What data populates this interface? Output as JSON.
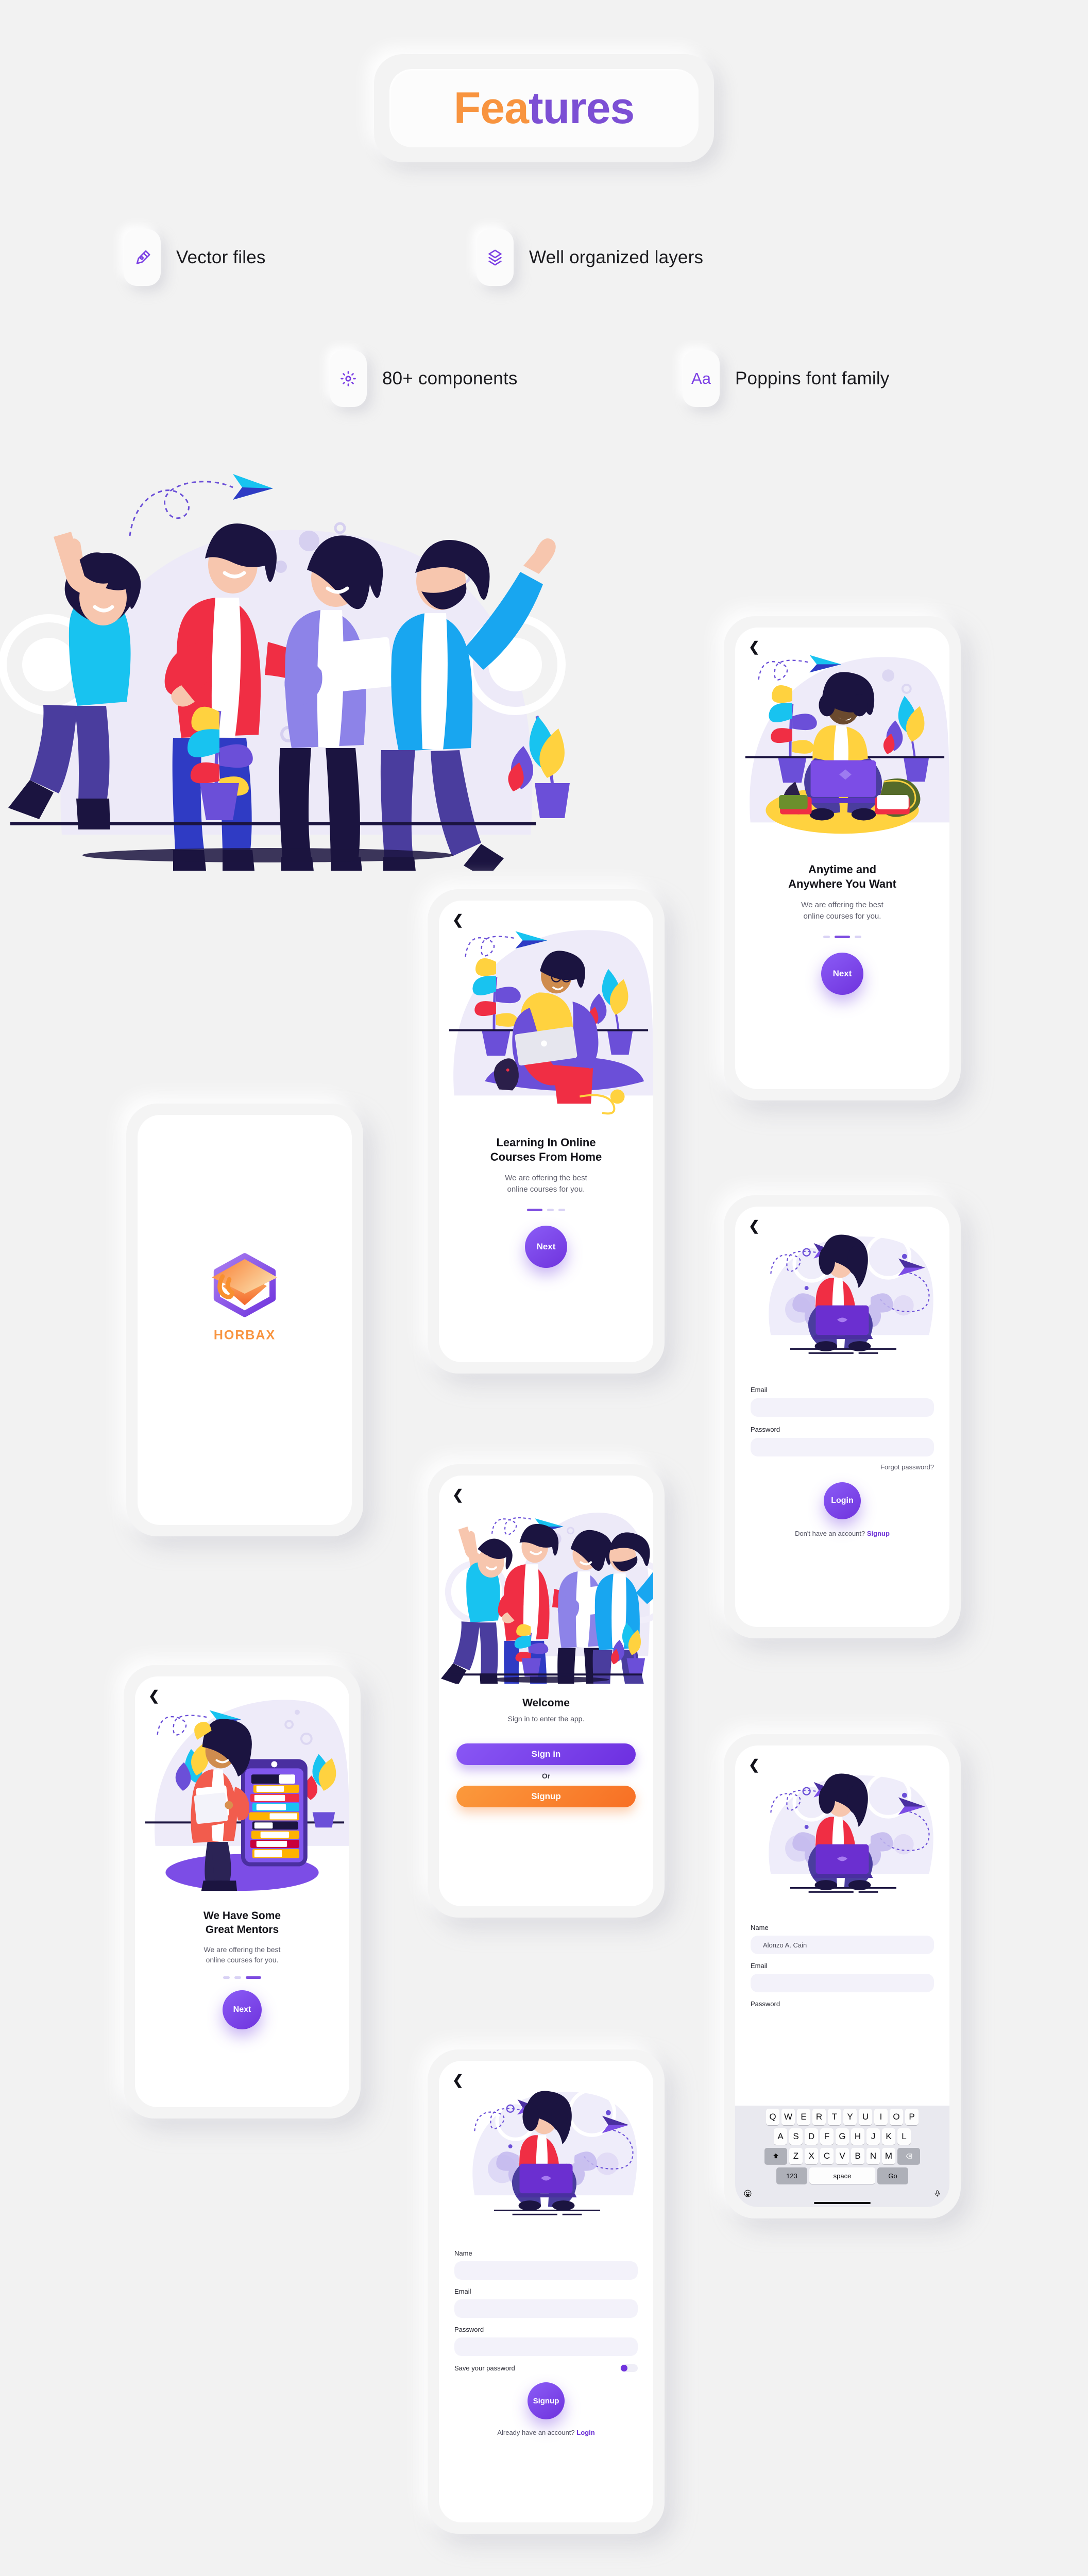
{
  "header": {
    "title_orange": "Fea",
    "title_purple": "tures"
  },
  "features": [
    {
      "icon": "pen-tool-icon",
      "label": "Vector files"
    },
    {
      "icon": "layers-icon",
      "label": "Well organized layers"
    },
    {
      "icon": "gear-icon",
      "label": "80+ components"
    },
    {
      "icon": "typography-icon",
      "label": "Poppins font family",
      "glyph": "Aa"
    }
  ],
  "splash": {
    "brand": "HORBAX"
  },
  "onboarding_1": {
    "title_line1": "Learning In Online",
    "title_line2": "Courses From Home",
    "sub_line1": "We are offering the best",
    "sub_line2": "online courses for you.",
    "button": "Next",
    "active_dot": 0,
    "dot_count": 3
  },
  "onboarding_2": {
    "title_line1": "Anytime and",
    "title_line2": "Anywhere You Want",
    "sub_line1": "We are offering the best",
    "sub_line2": "online courses for you.",
    "button": "Next",
    "active_dot": 1,
    "dot_count": 3
  },
  "onboarding_3": {
    "title_line1": "We Have Some",
    "title_line2": "Great Mentors",
    "sub_line1": "We are offering the best",
    "sub_line2": "online courses for you.",
    "button": "Next",
    "active_dot": 2,
    "dot_count": 3
  },
  "welcome": {
    "title": "Welcome",
    "subtitle": "Sign in to enter the app.",
    "signin_button": "Sign in",
    "or_label": "Or",
    "signup_button": "Signup"
  },
  "login": {
    "email_label": "Email",
    "email_value": "",
    "password_label": "Password",
    "password_value": "",
    "forgot_link": "Forgot password?",
    "login_button": "Login",
    "footer_text": "Don't have an account?",
    "footer_link": "Signup"
  },
  "signup": {
    "name_label": "Name",
    "name_value": "",
    "email_label": "Email",
    "email_value": "",
    "password_label": "Password",
    "password_value": "",
    "save_password_label": "Save your password",
    "save_password_on": true,
    "signup_button": "Signup",
    "footer_text": "Already have an account?",
    "footer_link": "Login"
  },
  "signup_keyboard": {
    "name_label": "Name",
    "name_value": "Alonzo A. Cain",
    "email_label": "Email",
    "email_value": "",
    "password_label": "Password",
    "keyboard": {
      "row1": [
        "Q",
        "W",
        "E",
        "R",
        "T",
        "Y",
        "U",
        "I",
        "O",
        "P"
      ],
      "row2": [
        "A",
        "S",
        "D",
        "F",
        "G",
        "H",
        "J",
        "K",
        "L"
      ],
      "row3": [
        "Z",
        "X",
        "C",
        "V",
        "B",
        "N",
        "M"
      ],
      "shift_key": "shift-icon",
      "backspace_key": "backspace-icon",
      "numbers_key": "123",
      "space_key": "space",
      "go_key": "Go",
      "emoji_key": "emoji-icon",
      "mic_key": "microphone-icon"
    }
  },
  "colors": {
    "purple": "#7b3fe4",
    "orange": "#f8943f",
    "background": "#f2f2f2",
    "field": "#f3f2fa"
  }
}
